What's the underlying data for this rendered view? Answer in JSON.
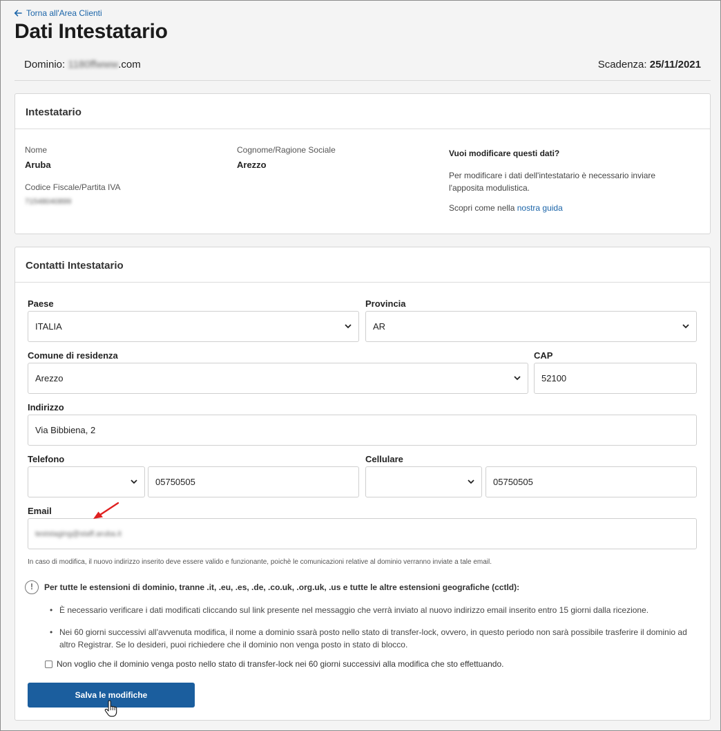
{
  "nav": {
    "back_label": "Torna all'Area Clienti"
  },
  "page": {
    "title": "Dati Intestatario"
  },
  "domain_bar": {
    "domain_label": "Dominio:",
    "domain_name_blurred": "1180ffwww",
    "domain_tld": ".com",
    "expiry_label": "Scadenza:",
    "expiry_value": "25/11/2021"
  },
  "owner_card": {
    "title": "Intestatario",
    "name_label": "Nome",
    "name_value": "Aruba",
    "surname_label": "Cognome/Ragione Sociale",
    "surname_value": "Arezzo",
    "tax_label": "Codice Fiscale/Partita IVA",
    "tax_value_blurred": "71548040899",
    "help_title": "Vuoi modificare questi dati?",
    "help_text": "Per modificare i dati dell'intestatario è necessario inviare l'apposita modulistica.",
    "help_guide_prefix": "Scopri come nella",
    "help_guide_link": "nostra guida"
  },
  "contacts_card": {
    "title": "Contatti Intestatario",
    "paese_label": "Paese",
    "paese_value": "ITALIA",
    "provincia_label": "Provincia",
    "provincia_value": "AR",
    "comune_label": "Comune di residenza",
    "comune_value": "Arezzo",
    "cap_label": "CAP",
    "cap_value": "52100",
    "indirizzo_label": "Indirizzo",
    "indirizzo_value": "Via Bibbiena, 2",
    "telefono_label": "Telefono",
    "telefono_prefix": "",
    "telefono_value": "05750505",
    "cellulare_label": "Cellulare",
    "cellulare_prefix": "",
    "cellulare_value": "05750505",
    "email_label": "Email",
    "email_value_blurred": "teststaging@staff.aruba.it",
    "email_note": "In caso di modifica, il nuovo indirizzo inserito deve essere valido e funzionante, poichè le comunicazioni relative al dominio verranno inviate a tale email.",
    "warning_title": "Per tutte le estensioni di dominio, tranne .it, .eu, .es, .de, .co.uk, .org.uk, .us e tutte le altre estensioni geografiche (cctld):",
    "bullet_1": "È necessario verificare i dati modificati cliccando sul link presente nel messaggio che verrà inviato al nuovo indirizzo email inserito entro 15 giorni dalla ricezione.",
    "bullet_2": "Nei 60 giorni successivi all'avvenuta modifica, il nome a dominio ssarà posto nello stato di transfer-lock, ovvero, in questo periodo non sarà possibile trasferire il dominio ad altro Registrar. Se lo desideri, puoi richiedere che il dominio non venga posto in stato di blocco.",
    "checkbox_label": "Non voglio che il dominio venga posto nello stato di transfer-lock nei 60 giorni successivi alla modifica che sto effettuando.",
    "save_label": "Salva le modifiche"
  },
  "colors": {
    "accent": "#1b5e9e",
    "link": "#1a64a8",
    "annotation_arrow": "#e02020"
  }
}
